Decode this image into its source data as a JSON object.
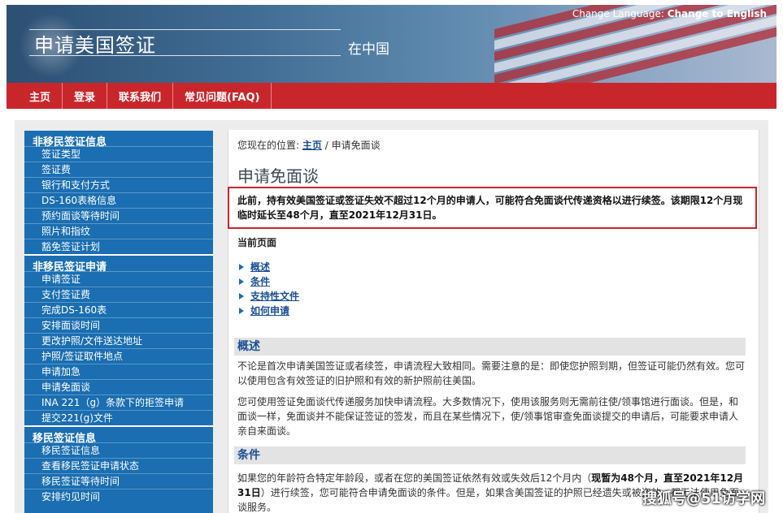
{
  "header": {
    "site_title": "申请美国签证",
    "site_subtitle": "在中国",
    "change_language_label": "Change Language:",
    "change_language_link": "Change to English"
  },
  "nav": {
    "items": [
      "主页",
      "登录",
      "联系我们",
      "常见问题(FAQ)"
    ]
  },
  "sidebar": {
    "sections": [
      {
        "title": "非移民签证信息",
        "items": [
          "签证类型",
          "签证费",
          "银行和支付方式",
          "DS-160表格信息",
          "预约面谈等待时间",
          "照片和指纹",
          "豁免签证计划"
        ]
      },
      {
        "title": "非移民签证申请",
        "items": [
          "申请签证",
          "支付签证费",
          "完成DS-160表",
          "安排面谈时间",
          "更改护照/文件送达地址",
          "护照/签证取件地点",
          "申请加急",
          "申请免面谈",
          "INA 221（g）条款下的拒签申请",
          "提交221(g)文件"
        ]
      },
      {
        "title": "移民签证信息",
        "items": [
          "移民签证信息",
          "查看移民签证申请状态",
          "移民签证等待时间",
          "安排约见时间"
        ]
      }
    ]
  },
  "breadcrumb": {
    "prefix": "您现在的位置:",
    "home": "主页",
    "separator": "/",
    "current": "申请免面谈"
  },
  "page_title": "申请免面谈",
  "notice": "此前，持有效美国签证或签证失效不超过12个月的申请人，可能符合免面谈代传递资格以进行续签。该期限12个月现临时延长至48个月，直至2021年12月31日。",
  "current_page_label": "当前页面",
  "toc": [
    "概述",
    "条件",
    "支持性文件",
    "如何申请"
  ],
  "overview": {
    "heading": "概述",
    "p1": "不论是首次申请美国签证或者续签，申请流程大致相同。需要注意的是：即使您护照到期，但签证可能仍然有效。您可以使用包含有效签证的旧护照和有效的新护照前往美国。",
    "p2": "您可使用签证免面谈代传递服务加快申请流程。大多数情况下，使用该服务则无需前往使/领事馆进行面谈。但是，和面谈一样，免面谈并不能保证签证的签发，而且在某些情况下，使/领事馆审查免面谈提交的申请后，可能要求申请人亲自来面谈。"
  },
  "conditions": {
    "heading": "条件",
    "p1_a": "如果您的年龄符合特定年龄段，或者在您的美国签证依然有效或失效后12个月内（",
    "p1_bold": "现暂为48个月，直至2021年12月31日",
    "p1_b": "）进行续签，您可能符合申请免面谈的条件。但是，如果含美国签证的护照已经遗失或被盗",
    "p1_c": "效，都无法使用免面谈服务。"
  },
  "watermark": "搜狐号@51访学网"
}
